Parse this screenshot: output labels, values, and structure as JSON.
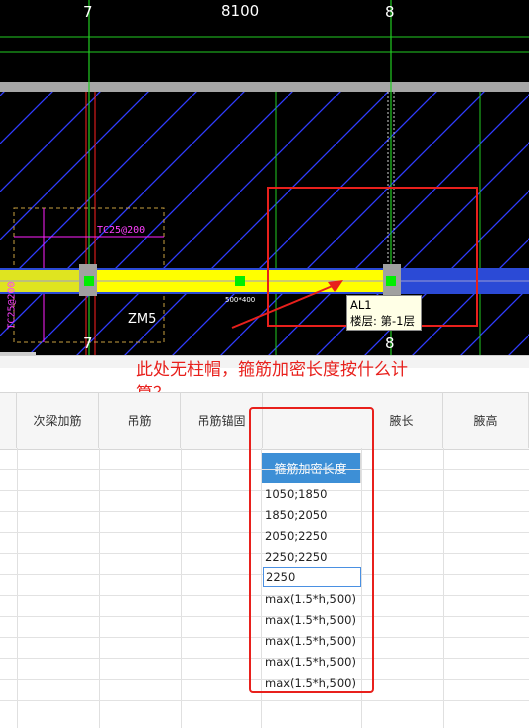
{
  "cad": {
    "axis_top_left": "7",
    "axis_top_right": "8",
    "axis_bottom_left": "7",
    "axis_bottom_right": "8",
    "dimension": "8100",
    "tc_label_h": "TC25@200",
    "tc_label_v": "TC25@200",
    "zm_label": "ZM5",
    "beam_size": "500*400",
    "tooltip_name": "AL1",
    "tooltip_floor": "楼层: 第-1层"
  },
  "annotation": {
    "question": "此处无柱帽，箍筋加密长度按什么计算？"
  },
  "table": {
    "headers": [
      "次梁加筋",
      "吊筋",
      "吊筋锚固",
      "箍筋加密长度",
      "腋长",
      "腋高"
    ],
    "active_header": "箍筋加密长度",
    "rows": [
      "1050;1850",
      "1850;2050",
      "2050;2250",
      "2250;2250",
      "2250",
      "max(1.5*h,500)",
      "max(1.5*h,500)",
      "max(1.5*h,500)",
      "max(1.5*h,500)",
      "max(1.5*h,500)"
    ]
  },
  "colors": {
    "background": "#000000",
    "beam": "#ffff00",
    "highlight_box": "#e8201c",
    "header_active": "#3d8fd6"
  }
}
